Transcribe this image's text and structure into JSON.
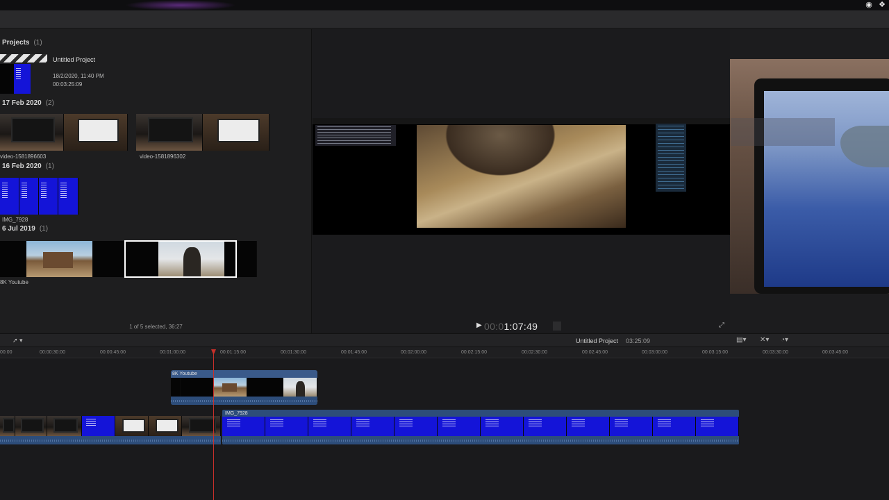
{
  "colors": {
    "selection_border": "#ffffff",
    "playhead": "#c8302a",
    "clip_blue": "#1414d8",
    "audio_lane": "#2d4d7a"
  },
  "browser": {
    "sections": [
      {
        "title": "Projects",
        "count": "(1)"
      },
      {
        "title": "17 Feb 2020",
        "count": "(2)"
      },
      {
        "title": "16 Feb 2020",
        "count": "(1)"
      },
      {
        "title": "6 Jul 2019",
        "count": "(1)"
      }
    ],
    "project": {
      "name": "Untitled Project",
      "date": "18/2/2020, 11:40 PM",
      "duration": "00:03:25:09"
    },
    "clips": {
      "video_a": "video-1581896603",
      "video_b": "video-1581896302",
      "img": "IMG_7928",
      "youtube": "8K Youtube"
    },
    "status": "1 of 5 selected, 36:27"
  },
  "viewer": {
    "timecode_dim": "00:0",
    "timecode": "1:07:49"
  },
  "timeline": {
    "project_name": "Untitled Project",
    "project_duration": "03:25:09",
    "ruler": [
      "00:00",
      "00:00:30:00",
      "00:00:45:00",
      "00:01:00:00",
      "00:01:15:00",
      "00:01:30:00",
      "00:01:45:00",
      "00:02:00:00",
      "00:02:15:00",
      "00:02:30:00",
      "00:02:45:00",
      "00:03:00:00",
      "00:03:15:00",
      "00:03:30:00",
      "00:03:45:00"
    ],
    "connected_clip": "8K Youtube",
    "primary_clip": "IMG_7928"
  },
  "icons": {
    "record": "record-icon",
    "dropbox": "dropbox-icon",
    "play": "play-icon",
    "fullscreen": "fullscreen-icon",
    "clip_appearance": "clip-appearance-icon",
    "effects": "effects-icon",
    "speed": "speed-icon",
    "select_tool": "select-tool-icon"
  }
}
